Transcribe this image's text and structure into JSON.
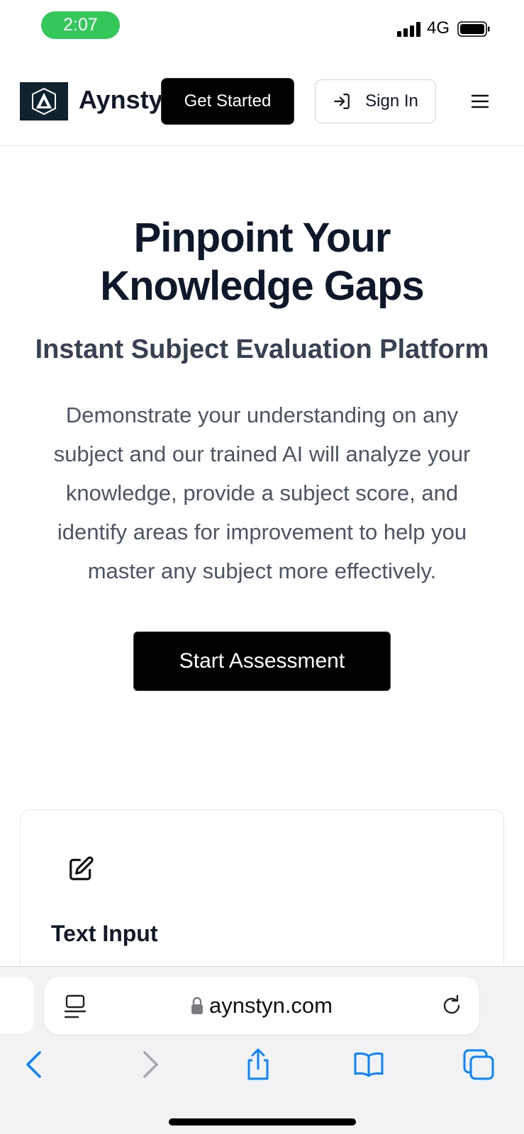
{
  "status_bar": {
    "time": "2:07",
    "network": "4G"
  },
  "header": {
    "logo_letter": "A",
    "brand_name": "Aynstyn",
    "get_started_label": "Get Started",
    "sign_in_label": "Sign In"
  },
  "hero": {
    "title_line1": "Pinpoint Your",
    "title_line2": "Knowledge Gaps",
    "subtitle": "Instant Subject Evaluation Platform",
    "description": "Demonstrate your understanding on any subject and our trained AI will analyze your knowledge, provide a subject score, and identify areas for improvement to help you master any subject more effectively.",
    "cta_label": "Start Assessment"
  },
  "feature_card": {
    "title": "Text Input",
    "icon": "edit-icon"
  },
  "browser": {
    "url": "aynstyn.com"
  },
  "colors": {
    "status_green": "#34c759",
    "logo_bg": "#0f2230",
    "ios_blue": "#0a84ff"
  }
}
